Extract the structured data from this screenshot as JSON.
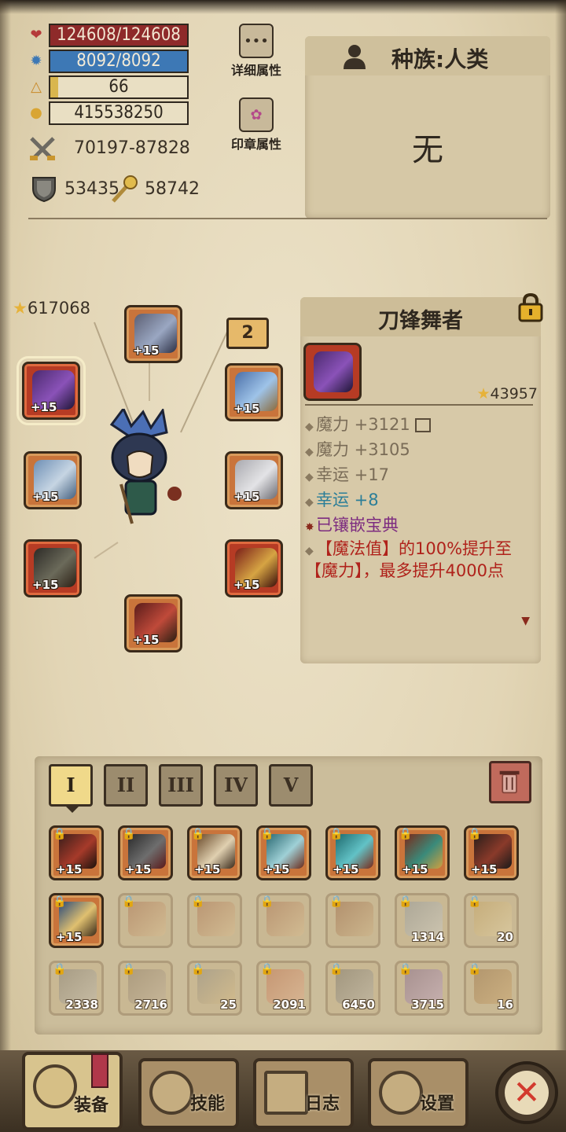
{
  "stats": {
    "hp": "124608/124608",
    "mp": "8092/8092",
    "level": "66",
    "level_progress": 0.06,
    "gold": "415538250",
    "attack": "70197-87828",
    "defense": "53435",
    "magic": "58742",
    "hp_color": "#8e2a2a",
    "mp_color": "#3d78b5"
  },
  "buttons": {
    "detail_attrs": "详细属性",
    "seal_attrs": "印章属性"
  },
  "race": {
    "title": "种族:人类",
    "value": "无"
  },
  "equip": {
    "total_score": "617068",
    "badge": "2",
    "slots": [
      {
        "level": "+15"
      },
      {
        "level": "+15"
      },
      {
        "level": "+15"
      },
      {
        "level": "+15"
      },
      {
        "level": "+15"
      },
      {
        "level": "+15"
      },
      {
        "level": "+15"
      },
      {
        "level": "+15"
      }
    ]
  },
  "detail": {
    "name": "刀锋舞者",
    "score": "43957",
    "attrs": [
      "魔力 +3121",
      "魔力 +3105",
      "幸运 +17",
      "幸运 +8",
      "已镶嵌宝典"
    ],
    "description": "【魔法值】的100%提升至【魔力】，最多提升4000点"
  },
  "tabs": [
    "I",
    "II",
    "III",
    "IV",
    "V"
  ],
  "inventory": {
    "row1": [
      "+15",
      "+15",
      "+15",
      "+15",
      "+15",
      "+15",
      "+15"
    ],
    "row2_first": "+15",
    "row2_counts": [
      "",
      "",
      "",
      "",
      "1314",
      "20"
    ],
    "row3_counts": [
      "2338",
      "2716",
      "25",
      "2091",
      "6450",
      "3715",
      "16"
    ]
  },
  "nav": {
    "equip": "装备",
    "skills": "技能",
    "log": "日志",
    "settings": "设置"
  }
}
